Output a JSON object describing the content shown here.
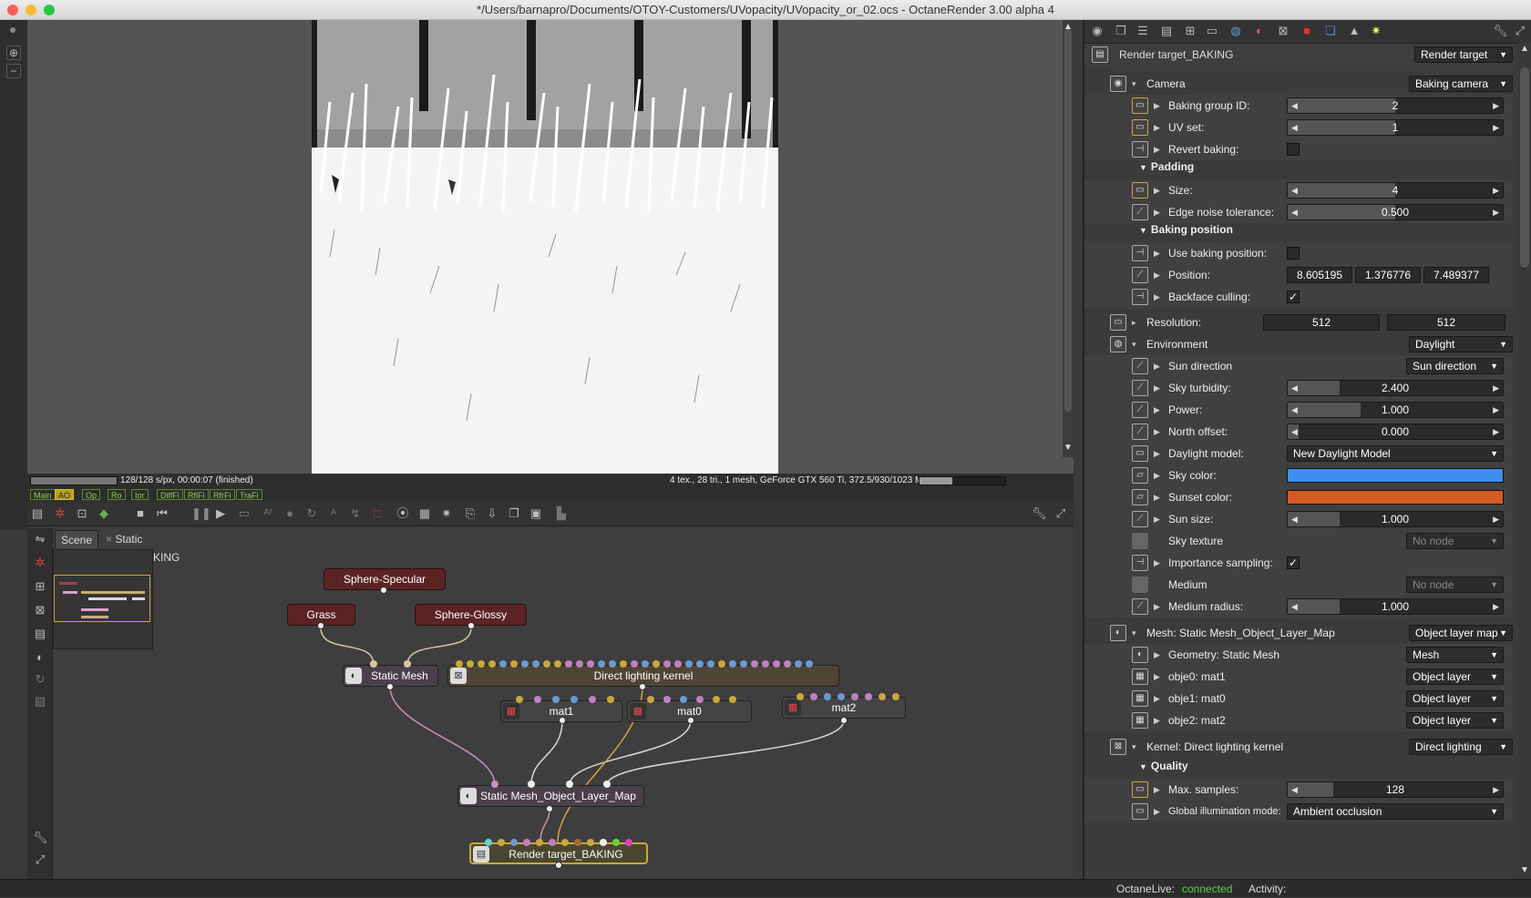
{
  "window": {
    "title": "*/Users/barnapro/Documents/OTOY-Customers/UVopacity/UVopacity_or_02.ocs - OctaneRender 3.00 alpha 4"
  },
  "render": {
    "progress_fraction": 1.0,
    "status_left": "128/128 s/px, 00:00:07 (finished)",
    "status_right": "4 tex., 28 tri., 1 mesh, GeForce GTX 560 Ti, 372.5/930/1023 MB",
    "memory_fraction": 0.38,
    "passes": [
      "Main",
      "AO",
      "Op",
      "Ro",
      "Ior",
      "DiffFi",
      "RflFi",
      "RfrFi",
      "TraFi"
    ],
    "active_pass": "AO"
  },
  "node_editor": {
    "tabs": [
      "Scene",
      "Static Mesh_BAKING"
    ],
    "nodes": {
      "sphere_specular": "Sphere-Specular",
      "grass": "Grass",
      "sphere_glossy": "Sphere-Glossy",
      "static_mesh": "Static Mesh",
      "direct_lighting_kernel": "Direct lighting kernel",
      "mat1": "mat1",
      "mat0": "mat0",
      "mat2": "mat2",
      "object_layer_map": "Static Mesh_Object_Layer_Map",
      "render_target": "Render target_BAKING"
    }
  },
  "inspector": {
    "header": {
      "label": "Render target_BAKING",
      "type": "Render target"
    },
    "camera": {
      "label": "Camera",
      "value": "Baking camera"
    },
    "baking_group_id": {
      "label": "Baking group ID:",
      "value": "2"
    },
    "uv_set": {
      "label": "UV set:",
      "value": "1"
    },
    "revert_baking": {
      "label": "Revert baking:"
    },
    "padding": {
      "label": "Padding"
    },
    "size": {
      "label": "Size:",
      "value": "4"
    },
    "edge_noise": {
      "label": "Edge noise tolerance:",
      "value": "0.500"
    },
    "baking_position": {
      "label": "Baking position"
    },
    "use_baking_position": {
      "label": "Use baking position:"
    },
    "position": {
      "label": "Position:",
      "x": "8.605195",
      "y": "1.376776",
      "z": "7.489377"
    },
    "backface_culling": {
      "label": "Backface culling:",
      "check": "✓"
    },
    "resolution": {
      "label": "Resolution:",
      "w": "512",
      "h": "512"
    },
    "environment": {
      "label": "Environment",
      "value": "Daylight"
    },
    "sun_direction": {
      "label": "Sun direction",
      "value": "Sun direction"
    },
    "sky_turbidity": {
      "label": "Sky turbidity:",
      "value": "2.400"
    },
    "power": {
      "label": "Power:",
      "value": "1.000"
    },
    "north_offset": {
      "label": "North offset:",
      "value": "0.000"
    },
    "daylight_model": {
      "label": "Daylight model:",
      "value": "New Daylight Model"
    },
    "sky_color": {
      "label": "Sky color:",
      "color": "#3d8ef0"
    },
    "sunset_color": {
      "label": "Sunset color:",
      "color": "#d65a24"
    },
    "sun_size": {
      "label": "Sun size:",
      "value": "1.000"
    },
    "sky_texture": {
      "label": "Sky texture",
      "value": "No node"
    },
    "importance_sampling": {
      "label": "Importance sampling:",
      "check": "✓"
    },
    "medium": {
      "label": "Medium",
      "value": "No node"
    },
    "medium_radius": {
      "label": "Medium radius:",
      "value": "1.000"
    },
    "mesh": {
      "label": "Mesh: Static Mesh_Object_Layer_Map",
      "value": "Object layer map"
    },
    "geometry": {
      "label": "Geometry: Static Mesh",
      "value": "Mesh"
    },
    "obje0": {
      "label": "obje0: mat1",
      "value": "Object layer"
    },
    "obje1": {
      "label": "obje1: mat0",
      "value": "Object layer"
    },
    "obje2": {
      "label": "obje2: mat2",
      "value": "Object layer"
    },
    "kernel": {
      "label": "Kernel: Direct lighting kernel",
      "value": "Direct lighting"
    },
    "quality": {
      "label": "Quality"
    },
    "max_samples": {
      "label": "Max. samples:",
      "value": "128"
    },
    "gi_mode": {
      "label": "Global illumination mode:",
      "value": "Ambient occlusion"
    }
  },
  "statusbar": {
    "label": "OctaneLive:",
    "status": "connected",
    "activity": "Activity:"
  }
}
